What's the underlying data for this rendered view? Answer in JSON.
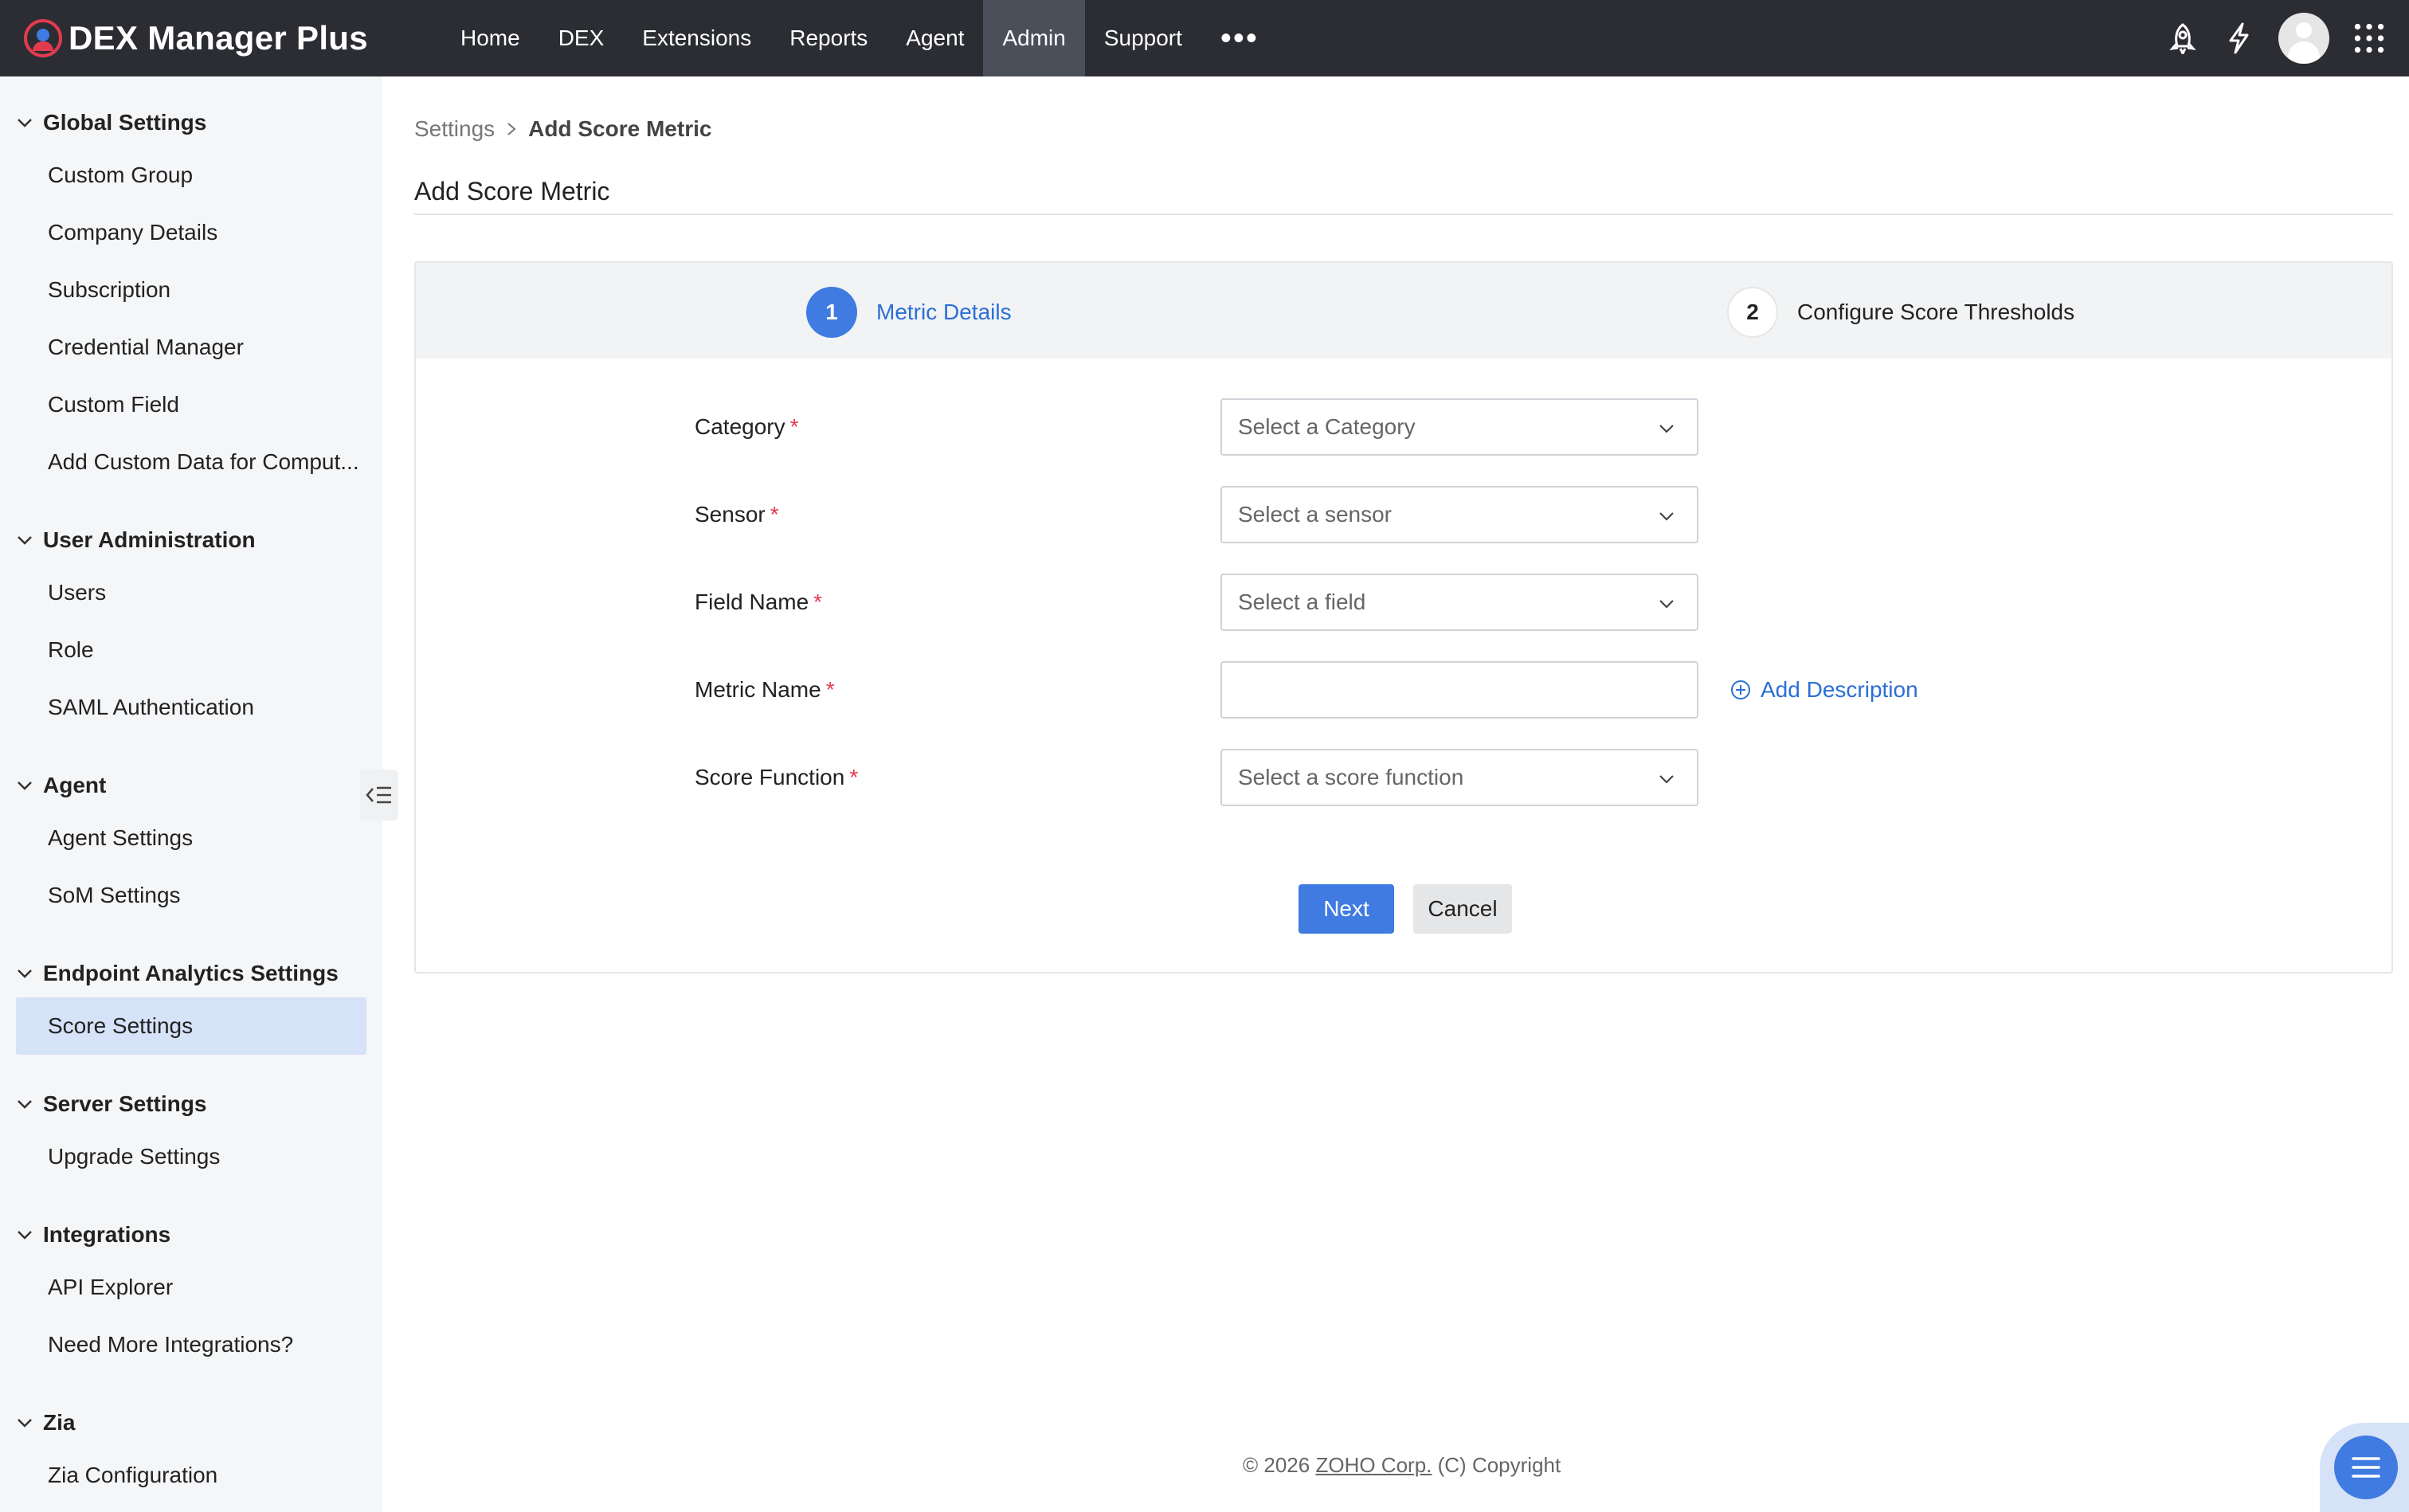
{
  "app": {
    "title": "DEX Manager Plus"
  },
  "nav": {
    "items": [
      "Home",
      "DEX",
      "Extensions",
      "Reports",
      "Agent",
      "Admin",
      "Support"
    ],
    "active": "Admin",
    "more": "•••"
  },
  "sidebar": {
    "groups": [
      {
        "title": "Global Settings",
        "items": [
          "Custom Group",
          "Company Details",
          "Subscription",
          "Credential Manager",
          "Custom Field",
          "Add Custom Data for Comput..."
        ]
      },
      {
        "title": "User Administration",
        "items": [
          "Users",
          "Role",
          "SAML Authentication"
        ]
      },
      {
        "title": "Agent",
        "items": [
          "Agent Settings",
          "SoM Settings"
        ]
      },
      {
        "title": "Endpoint Analytics Settings",
        "items": [
          "Score Settings"
        ]
      },
      {
        "title": "Server Settings",
        "items": [
          "Upgrade Settings"
        ]
      },
      {
        "title": "Integrations",
        "items": [
          "API Explorer",
          "Need More Integrations?"
        ]
      },
      {
        "title": "Zia",
        "items": [
          "Zia Configuration"
        ]
      }
    ],
    "active_item": "Score Settings"
  },
  "breadcrumb": {
    "parent": "Settings",
    "current": "Add Score Metric"
  },
  "page": {
    "title": "Add Score Metric"
  },
  "steps": [
    {
      "number": "1",
      "label": "Metric Details",
      "active": true
    },
    {
      "number": "2",
      "label": "Configure Score Thresholds",
      "active": false
    }
  ],
  "form": {
    "category": {
      "label": "Category",
      "placeholder": "Select a Category"
    },
    "sensor": {
      "label": "Sensor",
      "placeholder": "Select a sensor"
    },
    "field_name": {
      "label": "Field Name",
      "placeholder": "Select a field"
    },
    "metric_name": {
      "label": "Metric Name",
      "value": ""
    },
    "score_function": {
      "label": "Score Function",
      "placeholder": "Select a score function"
    },
    "required_mark": "*",
    "add_description": "Add Description"
  },
  "buttons": {
    "next": "Next",
    "cancel": "Cancel"
  },
  "footer": {
    "prefix": "© 2026",
    "link": "ZOHO Corp.",
    "suffix": "(C) Copyright"
  },
  "colors": {
    "accent": "#3f7be0",
    "topbar": "#2b2d33",
    "required": "#e23b4f",
    "sidebar_active": "#d6e2f7"
  }
}
